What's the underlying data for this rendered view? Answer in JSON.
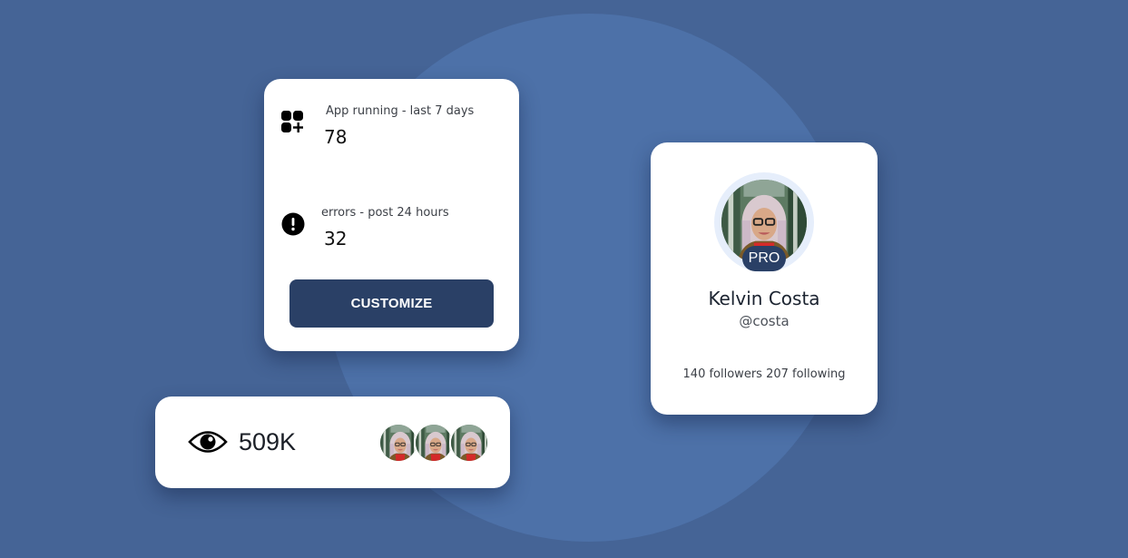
{
  "colors": {
    "background": "#456496",
    "circle": "#4d71a8",
    "card": "#ffffff",
    "accent": "#2a4066"
  },
  "stats": {
    "app_running": {
      "icon": "apps-add-icon",
      "label": "App running - last 7 days",
      "value": "78"
    },
    "errors": {
      "icon": "exclamation-circle-icon",
      "label": "errors - post 24 hours",
      "value": "32"
    },
    "button_label": "CUSTOMIZE"
  },
  "views": {
    "icon": "eye-icon",
    "count": "509K",
    "avatars": [
      "avatar",
      "avatar",
      "avatar"
    ]
  },
  "profile": {
    "badge": "PRO",
    "name": "Kelvin Costa",
    "handle": "@costa",
    "follow_text": "140 followers 207 following"
  }
}
